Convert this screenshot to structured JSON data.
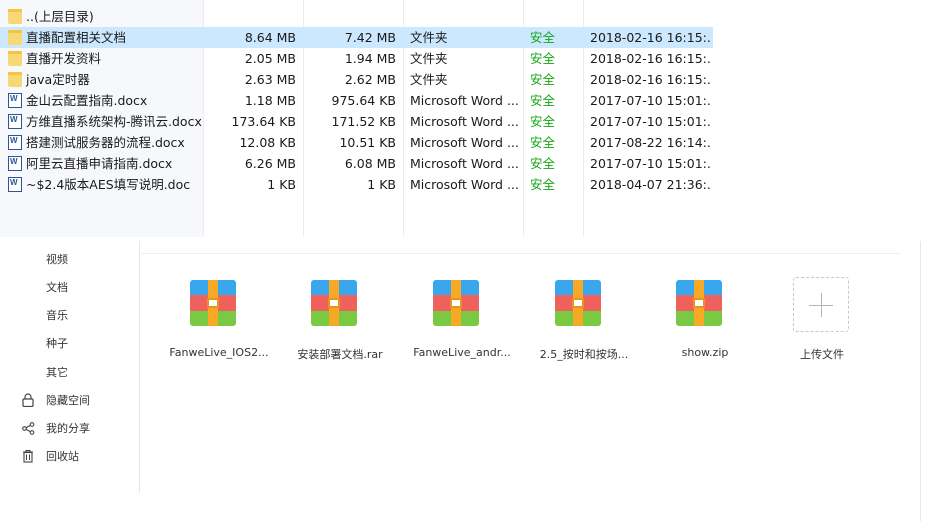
{
  "file_list": {
    "parent_row": {
      "name": "..(上层目录)"
    },
    "rows": [
      {
        "icon": "folder-icon",
        "name": "直播配置相关文档",
        "size": "8.64 MB",
        "compressed": "7.42 MB",
        "type": "文件夹",
        "security": "安全",
        "modified": "2018-02-16 16:15:...",
        "selected": true
      },
      {
        "icon": "folder-icon",
        "name": "直播开发资料",
        "size": "2.05 MB",
        "compressed": "1.94 MB",
        "type": "文件夹",
        "security": "安全",
        "modified": "2018-02-16 16:15:..."
      },
      {
        "icon": "folder-icon",
        "name": "java定时器",
        "size": "2.63 MB",
        "compressed": "2.62 MB",
        "type": "文件夹",
        "security": "安全",
        "modified": "2018-02-16 16:15:..."
      },
      {
        "icon": "word-doc-icon",
        "name": "金山云配置指南.docx",
        "size": "1.18 MB",
        "compressed": "975.64 KB",
        "type": "Microsoft Word ...",
        "security": "安全",
        "modified": "2017-07-10 15:01:..."
      },
      {
        "icon": "word-doc-icon",
        "name": "方维直播系统架构-腾讯云.docx",
        "size": "173.64 KB",
        "compressed": "171.52 KB",
        "type": "Microsoft Word ...",
        "security": "安全",
        "modified": "2017-07-10 15:01:..."
      },
      {
        "icon": "word-doc-icon",
        "name": "搭建测试服务器的流程.docx",
        "size": "12.08 KB",
        "compressed": "10.51 KB",
        "type": "Microsoft Word ...",
        "security": "安全",
        "modified": "2017-08-22 16:14:..."
      },
      {
        "icon": "word-doc-icon",
        "name": "阿里云直播申请指南.docx",
        "size": "6.26 MB",
        "compressed": "6.08 MB",
        "type": "Microsoft Word ...",
        "security": "安全",
        "modified": "2017-07-10 15:01:..."
      },
      {
        "icon": "word-doc-icon",
        "name": "~$2.4版本AES填写说明.doc",
        "size": "1 KB",
        "compressed": "1 KB",
        "type": "Microsoft Word ...",
        "security": "安全",
        "modified": "2018-04-07 21:36:..."
      }
    ]
  },
  "sidebar": {
    "items": [
      {
        "label": "视频"
      },
      {
        "label": "文档"
      },
      {
        "label": "音乐"
      },
      {
        "label": "种子"
      },
      {
        "label": "其它"
      },
      {
        "label": "隐藏空间",
        "icon": "lock-icon"
      },
      {
        "label": "我的分享",
        "icon": "share-icon"
      },
      {
        "label": "回收站",
        "icon": "trash-icon"
      }
    ]
  },
  "files": [
    {
      "name": "FanweLive_IOS2...",
      "icon": "archive-icon"
    },
    {
      "name": "安装部署文档.rar",
      "icon": "archive-icon"
    },
    {
      "name": "FanweLive_andr...",
      "icon": "archive-icon"
    },
    {
      "name": "2.5_按时和按场...",
      "icon": "archive-icon"
    },
    {
      "name": "show.zip",
      "icon": "archive-icon"
    }
  ],
  "upload": {
    "label": "上传文件",
    "icon": "plus-icon"
  },
  "colors": {
    "selected_row": "#cce8ff",
    "security_ok": "#14a814",
    "folder": "#f8d775"
  }
}
